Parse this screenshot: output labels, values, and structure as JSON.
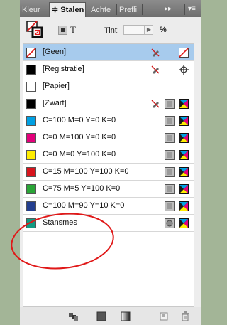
{
  "tabs": [
    {
      "label": "Kleur"
    },
    {
      "label": "≑ Stalen"
    },
    {
      "label": "Achte"
    },
    {
      "label": "Prefli"
    }
  ],
  "toolbar": {
    "fill_stroke_icon": "fill-stroke-icon",
    "tint_label": "Tint:",
    "tint_value": "",
    "tint_unit": "%"
  },
  "swatches": [
    {
      "name": "[Geen]",
      "color": "none",
      "selected": true
    },
    {
      "name": "[Registratie]",
      "color": "#000000"
    },
    {
      "name": "[Papier]",
      "color": "#ffffff"
    },
    {
      "name": "[Zwart]",
      "color": "#000000"
    },
    {
      "name": "C=100 M=0 Y=0 K=0",
      "color": "#00a0e3"
    },
    {
      "name": "C=0 M=100 Y=0 K=0",
      "color": "#e3007b"
    },
    {
      "name": "C=0 M=0 Y=100 K=0",
      "color": "#ffed00"
    },
    {
      "name": "C=15 M=100 Y=100 K=0",
      "color": "#d7141d"
    },
    {
      "name": "C=75 M=5 Y=100 K=0",
      "color": "#2aa537"
    },
    {
      "name": "C=100 M=90 Y=10 K=0",
      "color": "#243f8f"
    },
    {
      "name": "Stansmes",
      "color": "#139a82"
    }
  ],
  "colors": {
    "selection": "#a7cbed",
    "annotation": "#e01818"
  }
}
